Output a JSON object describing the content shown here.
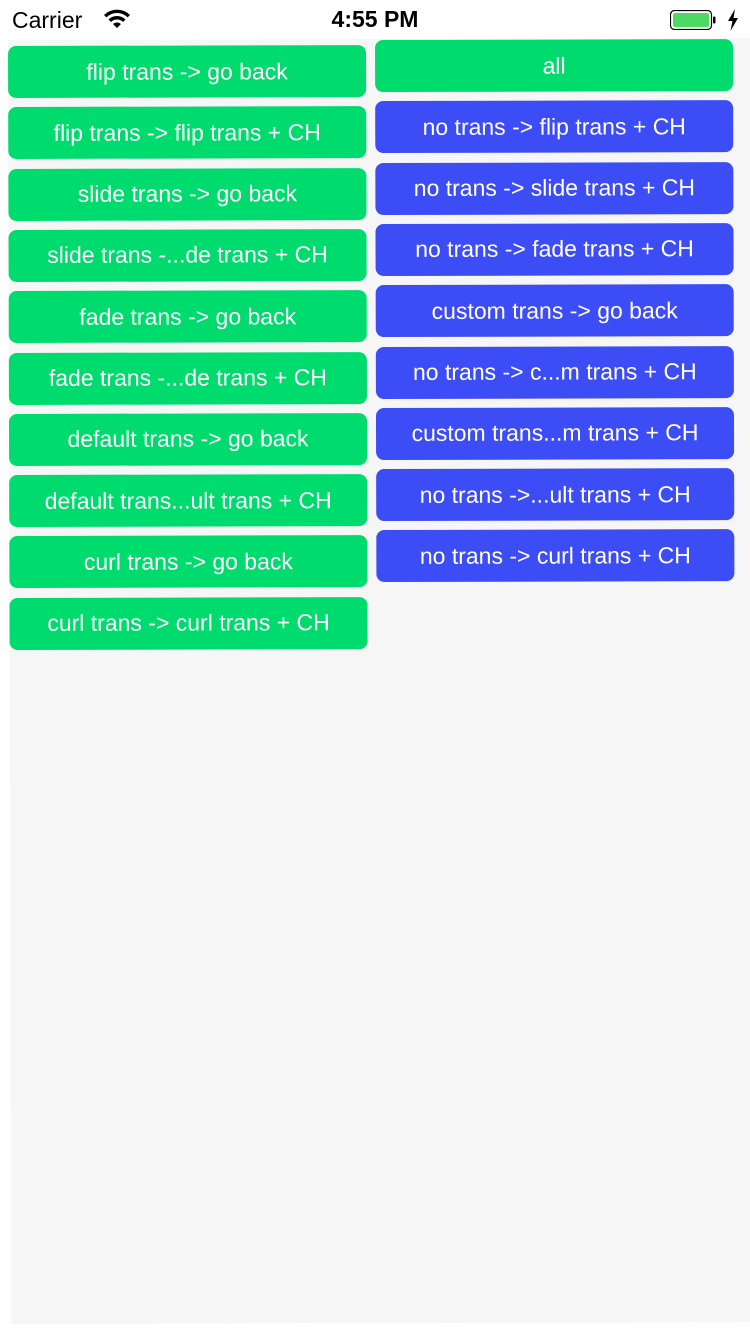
{
  "status_bar": {
    "carrier": "Carrier",
    "time": "4:55 PM",
    "wifi_icon": "wifi-icon",
    "battery_icon": "battery-icon",
    "charging_icon": "bolt-icon",
    "battery_color": "#4cd964"
  },
  "colors": {
    "green": "#00db6e",
    "blue": "#3c4df5",
    "background": "#f6f6f6"
  },
  "left_buttons": [
    "flip trans -> go back",
    "flip trans -> flip trans + CH",
    "slide trans -> go back",
    "slide trans -...de trans + CH",
    "fade trans -> go back",
    "fade trans -...de trans + CH",
    "default trans -> go back",
    "default trans...ult trans + CH",
    "curl trans -> go back",
    "curl trans -> curl trans + CH"
  ],
  "right_buttons": [
    "all",
    "no trans -> flip trans + CH",
    "no trans -> slide trans + CH",
    "no trans -> fade trans + CH",
    "custom trans -> go back",
    "no trans -> c...m trans + CH",
    "custom trans...m trans + CH",
    "no trans ->...ult trans + CH",
    "no trans -> curl trans + CH"
  ]
}
